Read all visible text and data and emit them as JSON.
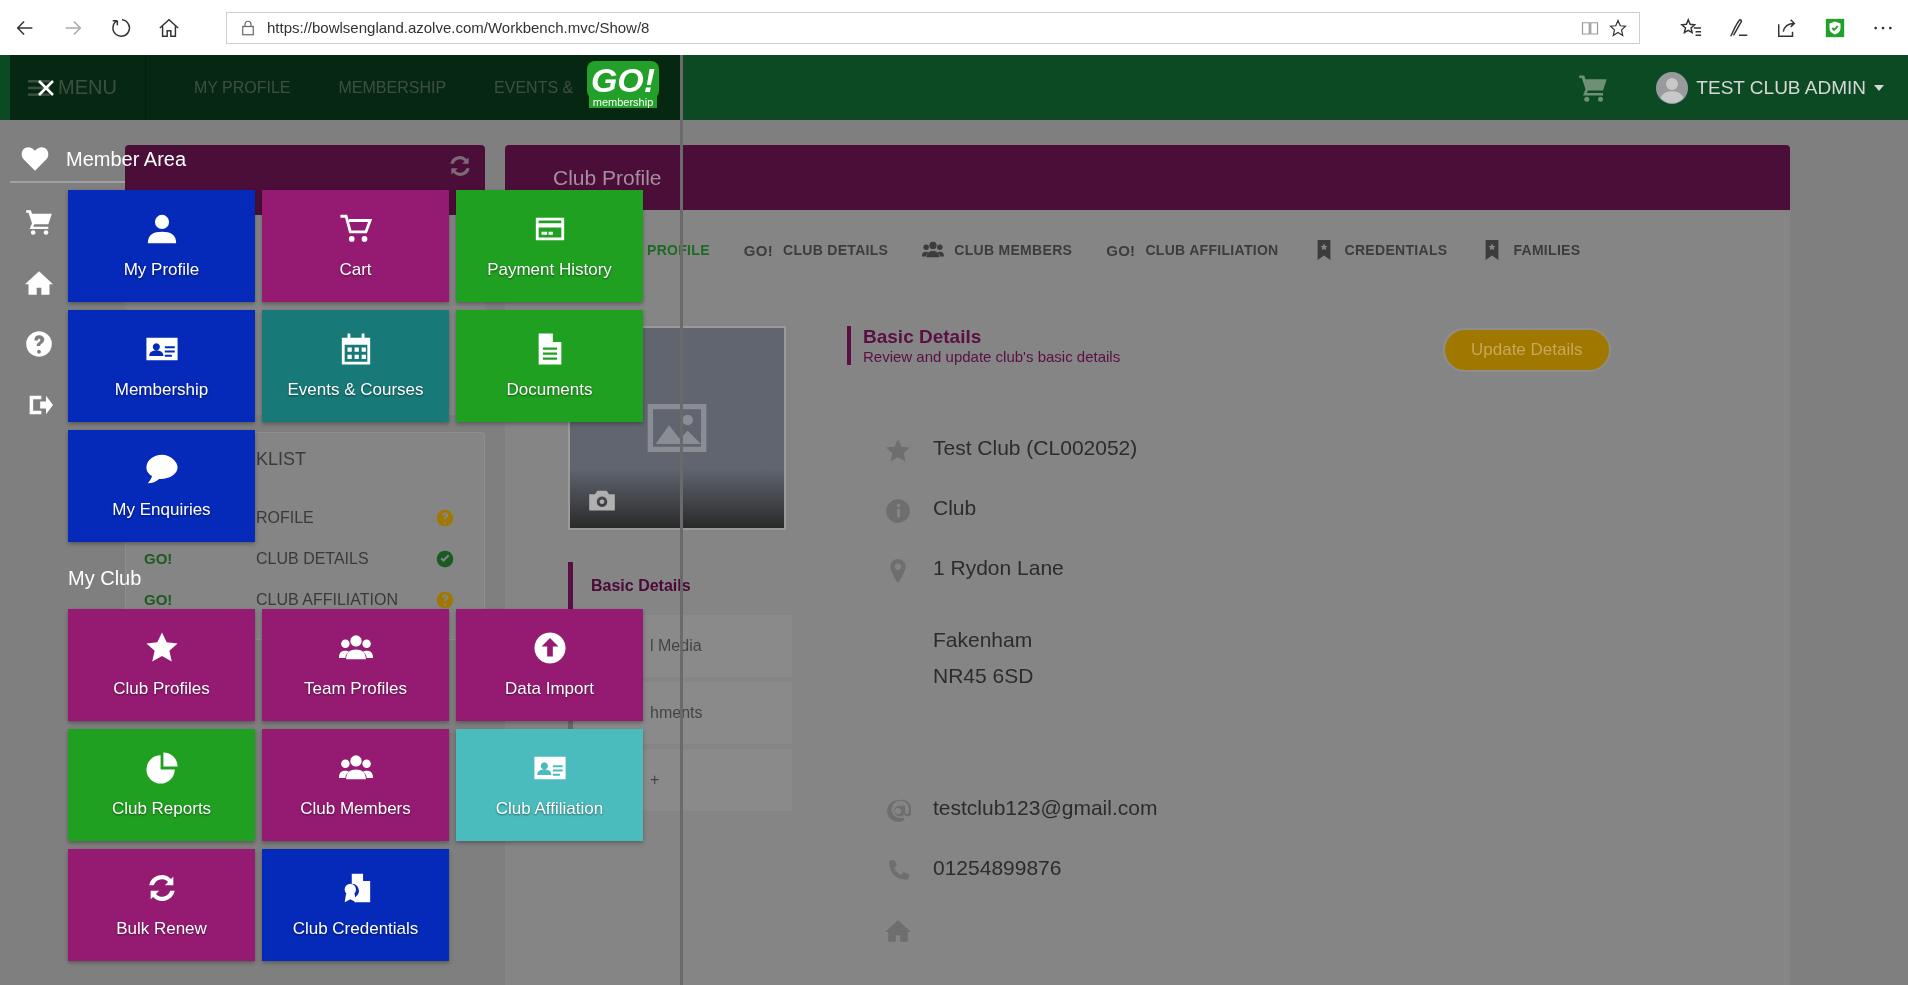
{
  "browser": {
    "url": "https://bowlsengland.azolve.com/Workbench.mvc/Show/8"
  },
  "header": {
    "menu_label": "MENU",
    "nav": [
      "MY PROFILE",
      "MEMBERSHIP",
      "EVENTS &"
    ],
    "user": "TEST CLUB ADMIN"
  },
  "logo": {
    "word": "GO!",
    "tagline": "membership"
  },
  "drawer": {
    "sections": [
      {
        "title": "Member Area",
        "tiles": [
          {
            "label": "My Profile",
            "color": "#0529b8"
          },
          {
            "label": "Cart",
            "color": "#951b72"
          },
          {
            "label": "Payment History",
            "color": "#20a020"
          },
          {
            "label": "Membership",
            "color": "#0529b8"
          },
          {
            "label": "Events & Courses",
            "color": "#177a78"
          },
          {
            "label": "Documents",
            "color": "#20a020"
          },
          {
            "label": "My Enquiries",
            "color": "#0529b8"
          }
        ]
      },
      {
        "title": "My Club",
        "tiles": [
          {
            "label": "Club Profiles",
            "color": "#951b72"
          },
          {
            "label": "Team Profiles",
            "color": "#951b72"
          },
          {
            "label": "Data Import",
            "color": "#951b72"
          },
          {
            "label": "Club Reports",
            "color": "#20a020"
          },
          {
            "label": "Club Members",
            "color": "#951b72"
          },
          {
            "label": "Club Affiliation",
            "color": "#4bbcbd"
          },
          {
            "label": "Bulk Renew",
            "color": "#951b72"
          },
          {
            "label": "Club Credentials",
            "color": "#0529b8"
          }
        ]
      }
    ]
  },
  "checklist": {
    "title": "KLIST",
    "items": [
      {
        "label": "ROFILE",
        "complete": false
      },
      {
        "badge": "GO!",
        "label": "CLUB DETAILS",
        "complete": true
      },
      {
        "badge": "GO!",
        "label": "CLUB AFFILIATION",
        "complete": false
      }
    ]
  },
  "profile": {
    "title": "Club Profile",
    "tabs": [
      {
        "label": "PROFILE",
        "selected": true
      },
      {
        "badge": "GO!",
        "label": "CLUB DETAILS",
        "selected": false
      },
      {
        "kind": "members",
        "label": "CLUB MEMBERS",
        "selected": false
      },
      {
        "badge": "GO!",
        "label": "CLUB AFFILIATION",
        "selected": false
      },
      {
        "kind": "bookmark",
        "label": "CREDENTIALS",
        "selected": false
      },
      {
        "kind": "bookmark",
        "label": "FAMILIES",
        "selected": false
      }
    ],
    "side_tabs": [
      {
        "label": "Basic Details",
        "selected": true
      },
      {
        "label": "l Media",
        "selected": false
      },
      {
        "label": "hments",
        "selected": false
      },
      {
        "label": "+",
        "selected": false
      }
    ],
    "section": {
      "title": "Basic Details",
      "subtitle": "Review and update club's basic details",
      "button": "Update Details"
    },
    "fields": [
      {
        "kind": "name",
        "lines": [
          "Test Club (CL002052)"
        ]
      },
      {
        "kind": "type",
        "lines": [
          "Club"
        ]
      },
      {
        "kind": "address",
        "lines": [
          "1 Rydon Lane"
        ]
      },
      {
        "kind": "address_more",
        "lines": [
          "Fakenham",
          "NR45 6SD"
        ]
      },
      {
        "kind": "email",
        "lines": [
          "testclub123@gmail.com"
        ]
      },
      {
        "kind": "phone",
        "lines": [
          "01254899876"
        ]
      },
      {
        "kind": "home"
      }
    ]
  }
}
